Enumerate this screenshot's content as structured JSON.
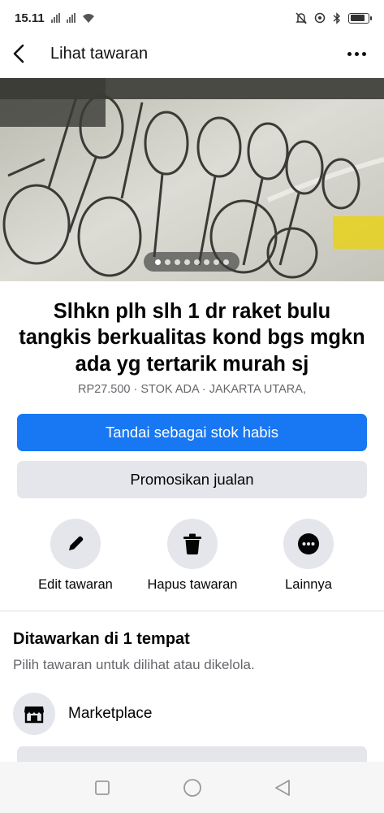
{
  "status_bar": {
    "time": "15.11",
    "battery_level": 0.85
  },
  "app_bar": {
    "title": "Lihat tawaran",
    "back_icon": "back-arrow-icon",
    "more_icon": "more-horizontal-icon"
  },
  "photo": {
    "total_images": 8,
    "current_index": 0
  },
  "listing": {
    "title": "Slhkn plh slh 1 dr raket bulu tangkis berkualitas kond bgs mgkn ada yg tertarik murah sj",
    "meta": "RP27.500 · STOK ADA · JAKARTA UTARA,"
  },
  "buttons": {
    "mark_sold": "Tandai sebagai stok habis",
    "promote": "Promosikan jualan"
  },
  "actions": [
    {
      "label": "Edit tawaran",
      "icon": "pencil-icon"
    },
    {
      "label": "Hapus tawaran",
      "icon": "trash-icon"
    },
    {
      "label": "Lainnya",
      "icon": "more-icon"
    }
  ],
  "offered_section": {
    "title": "Ditawarkan di 1 tempat",
    "subtitle": "Pilih tawaran untuk dilihat atau dikelola.",
    "places": [
      {
        "label": "Marketplace",
        "icon": "storefront-icon"
      }
    ]
  },
  "colors": {
    "accent": "#1877f2",
    "secondary_button": "#e4e6eb",
    "muted_text": "#65676b"
  }
}
